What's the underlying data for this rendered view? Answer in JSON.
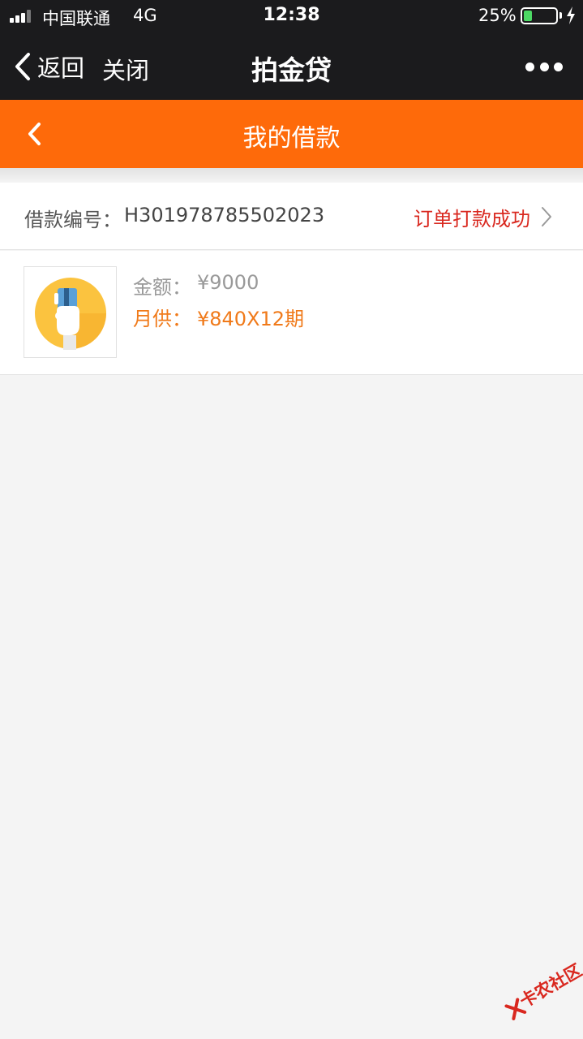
{
  "status_bar": {
    "carrier": "中国联通",
    "network": "4G",
    "time": "12:38",
    "battery_percent": "25%",
    "battery_level": 0.25
  },
  "nav_bar": {
    "back_label": "返回",
    "close_label": "关闭",
    "title": "拍金贷",
    "more_icon": "more-dots-icon"
  },
  "header": {
    "back_icon": "chevron-left-icon",
    "title": "我的借款"
  },
  "loan": {
    "number_label": "借款编号：",
    "number_value": "H301978785502023",
    "status": "订单打款成功",
    "thumbnail_icon": "card-in-hand-icon",
    "amount_label": "金额：",
    "amount_value": "¥9000",
    "monthly_label": "月供：",
    "monthly_value": "¥840X12期"
  },
  "watermark": {
    "text": "卡农社区"
  },
  "colors": {
    "top_bar": "#1b1b1d",
    "header": "#fe6a0a",
    "status_text": "#d9281f",
    "monthly_text": "#f07a1a",
    "page_bg": "#f4f4f4"
  }
}
